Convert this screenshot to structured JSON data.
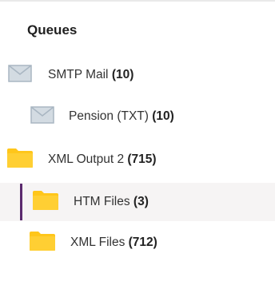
{
  "panel": {
    "title": "Queues"
  },
  "queues": [
    {
      "name": "SMTP Mail",
      "count": "(10)",
      "icon": "envelope-icon",
      "level": 0,
      "selected": false
    },
    {
      "name": "Pension (TXT)",
      "count": "(10)",
      "icon": "envelope-icon",
      "level": 1,
      "selected": false
    },
    {
      "name": "XML Output 2",
      "count": "(715)",
      "icon": "folder-icon",
      "level": 0,
      "selected": false
    },
    {
      "name": "HTM Files",
      "count": "(3)",
      "icon": "folder-icon",
      "level": 1,
      "selected": true
    },
    {
      "name": "XML Files",
      "count": "(712)",
      "icon": "folder-icon",
      "level": 1,
      "selected": false
    }
  ],
  "colors": {
    "folder": "#ffc61a",
    "envelope": "#a9b6c2",
    "selection_bar": "#5b2a6e",
    "selection_bg": "#f6f4f4"
  }
}
